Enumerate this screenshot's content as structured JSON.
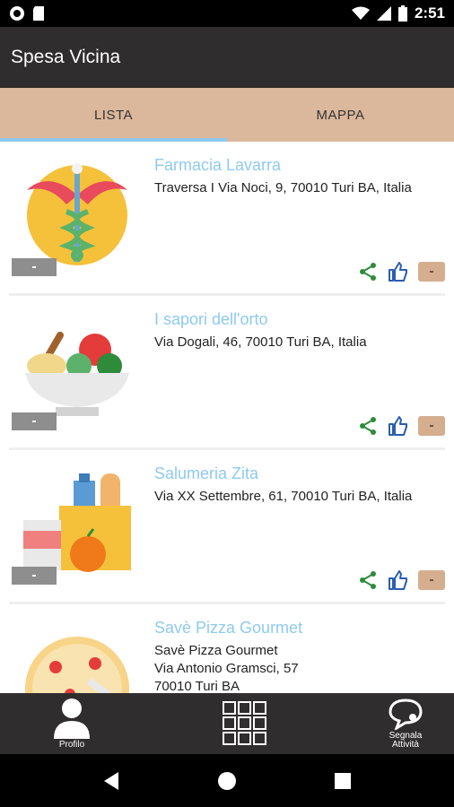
{
  "status_bar": {
    "time": "2:51"
  },
  "app_bar": {
    "title": "Spesa Vicina"
  },
  "tabs": [
    {
      "label": "LISTA",
      "active": true
    },
    {
      "label": "MAPPA",
      "active": false
    }
  ],
  "shops": [
    {
      "name": "Farmacia Lavarra",
      "address": "Traversa I Via Noci, 9, 70010 Turi BA, Italia",
      "icon": "caduceus-icon"
    },
    {
      "name": "I sapori dell'orto",
      "address": "Via Dogali, 46, 70010 Turi BA, Italia",
      "icon": "salad-bowl-icon"
    },
    {
      "name": "Salumeria Zita",
      "address": "Via XX Settembre, 61, 70010 Turi BA, Italia",
      "icon": "groceries-icon"
    },
    {
      "name": "Savè Pizza Gourmet",
      "address": "Savè Pizza Gourmet\nVia Antonio Gramsci, 57\n70010 Turi BA",
      "icon": "pizza-icon"
    }
  ],
  "bottom_bar": {
    "profile_label": "Profilo",
    "report_label": "Segnala Attività"
  },
  "colors": {
    "accent": "#8ecaf0",
    "tabs_bg": "#dbb79b",
    "bar_bg": "#2f2d2d",
    "share_green": "#2e8b3a",
    "like_blue": "#2a5db0"
  }
}
